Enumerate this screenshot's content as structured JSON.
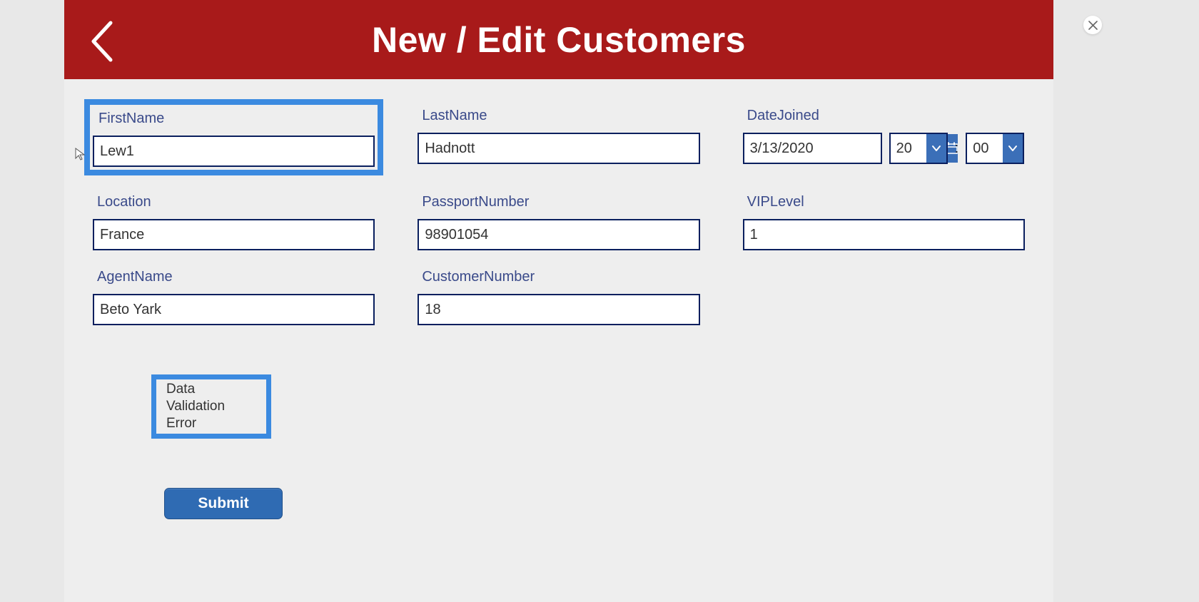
{
  "header": {
    "title": "New / Edit Customers"
  },
  "fields": {
    "firstName": {
      "label": "FirstName",
      "value": "Lew1"
    },
    "lastName": {
      "label": "LastName",
      "value": "Hadnott"
    },
    "dateJoined": {
      "label": "DateJoined",
      "date": "3/13/2020",
      "hour": "20",
      "minute": "00"
    },
    "location": {
      "label": "Location",
      "value": "France"
    },
    "passportNumber": {
      "label": "PassportNumber",
      "value": "98901054"
    },
    "vipLevel": {
      "label": "VIPLevel",
      "value": "1"
    },
    "agentName": {
      "label": "AgentName",
      "value": "Beto Yark"
    },
    "customerNumber": {
      "label": "CustomerNumber",
      "value": "18"
    }
  },
  "timeSeparator": ":",
  "error": {
    "message": "Data Validation Error"
  },
  "buttons": {
    "submit": "Submit"
  }
}
